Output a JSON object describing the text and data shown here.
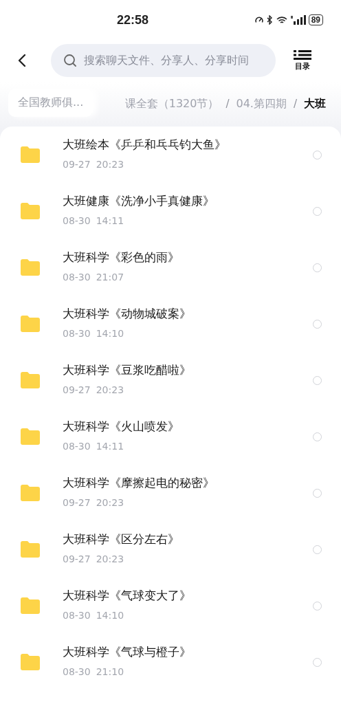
{
  "status_bar": {
    "time": "22:58",
    "battery": "89"
  },
  "header": {
    "search": {
      "placeholder": "搜索聊天文件、分享人、分享时间"
    },
    "toc_label": "目录"
  },
  "breadcrumb": {
    "root": "全国教师俱...",
    "separator": "/",
    "items": [
      {
        "label": "课全套（1320节）",
        "current": false
      },
      {
        "label": "04.第四期",
        "current": false
      },
      {
        "label": "大班",
        "current": true
      }
    ]
  },
  "files": [
    {
      "name": "大班绘本《乒乒和乓乓钓大鱼》",
      "date": "09-27",
      "time": "20:23",
      "selected": false
    },
    {
      "name": "大班健康《洗净小手真健康》",
      "date": "08-30",
      "time": "14:11",
      "selected": false
    },
    {
      "name": "大班科学《彩色的雨》",
      "date": "08-30",
      "time": "21:07",
      "selected": false
    },
    {
      "name": "大班科学《动物城破案》",
      "date": "08-30",
      "time": "14:10",
      "selected": false
    },
    {
      "name": "大班科学《豆浆吃醋啦》",
      "date": "09-27",
      "time": "20:23",
      "selected": false
    },
    {
      "name": "大班科学《火山喷发》",
      "date": "08-30",
      "time": "14:11",
      "selected": false
    },
    {
      "name": "大班科学《摩擦起电的秘密》",
      "date": "09-27",
      "time": "20:23",
      "selected": false
    },
    {
      "name": "大班科学《区分左右》",
      "date": "09-27",
      "time": "20:23",
      "selected": false
    },
    {
      "name": "大班科学《气球变大了》",
      "date": "08-30",
      "time": "14:10",
      "selected": false
    },
    {
      "name": "大班科学《气球与橙子》",
      "date": "08-30",
      "time": "21:10",
      "selected": false
    }
  ]
}
